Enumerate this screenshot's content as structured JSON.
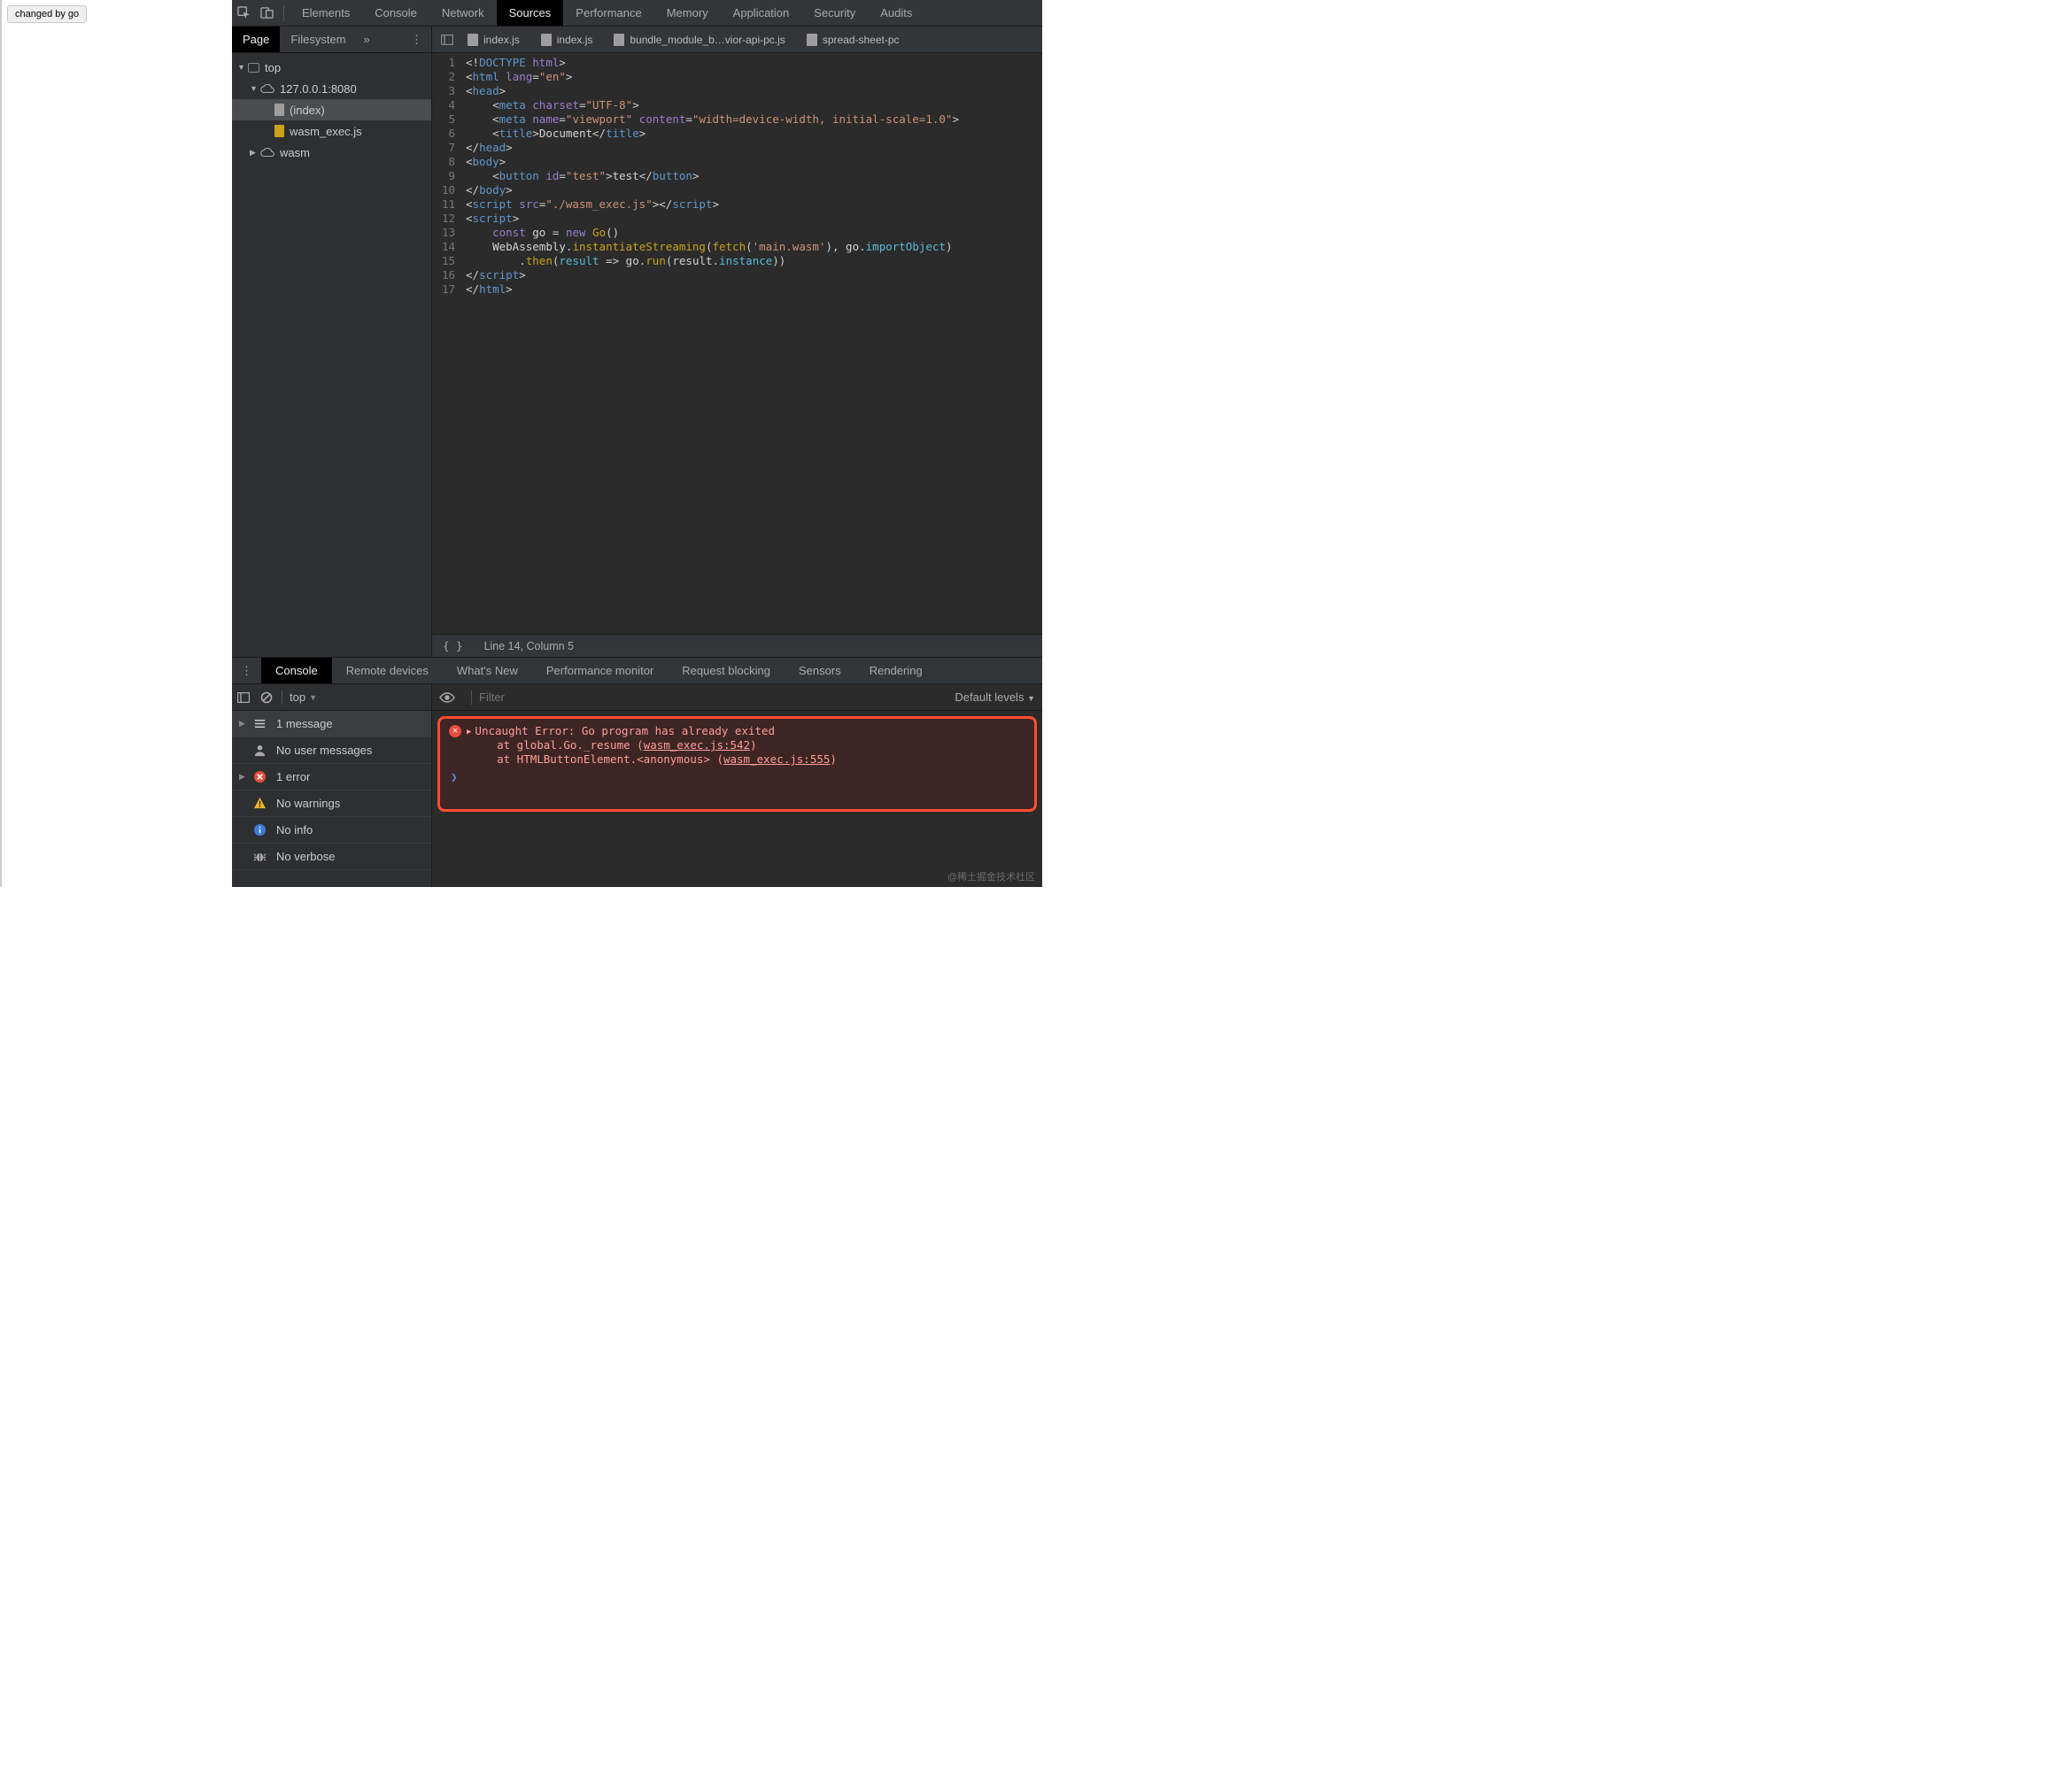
{
  "page": {
    "button_label": "changed by go"
  },
  "topbar": {
    "tabs": [
      "Elements",
      "Console",
      "Network",
      "Sources",
      "Performance",
      "Memory",
      "Application",
      "Security",
      "Audits"
    ],
    "active": "Sources"
  },
  "nav": {
    "tabs": {
      "page": "Page",
      "filesystem": "Filesystem"
    },
    "tree": {
      "top": "top",
      "host": "127.0.0.1:8080",
      "index": "(index)",
      "wasm_exec": "wasm_exec.js",
      "wasm_folder": "wasm"
    }
  },
  "file_tabs": [
    "index.js",
    "index.js",
    "bundle_module_b…vior-api-pc.js",
    "spread-sheet-pc"
  ],
  "code": {
    "lines": [
      {
        "n": 1,
        "h": "<span class='tk-punc'>&lt;!</span><span class='tk-tag'>DOCTYPE</span> <span class='tk-attr'>html</span><span class='tk-punc'>&gt;</span>"
      },
      {
        "n": 2,
        "h": "<span class='tk-punc'>&lt;</span><span class='tk-tag'>html</span> <span class='tk-attr'>lang</span><span class='tk-punc'>=</span><span class='tk-str'>\"en\"</span><span class='tk-punc'>&gt;</span>"
      },
      {
        "n": 3,
        "h": "<span class='tk-punc'>&lt;</span><span class='tk-tag'>head</span><span class='tk-punc'>&gt;</span>"
      },
      {
        "n": 4,
        "h": "    <span class='tk-punc'>&lt;</span><span class='tk-tag'>meta</span> <span class='tk-attr'>charset</span><span class='tk-punc'>=</span><span class='tk-str'>\"UTF-8\"</span><span class='tk-punc'>&gt;</span>"
      },
      {
        "n": 5,
        "h": "    <span class='tk-punc'>&lt;</span><span class='tk-tag'>meta</span> <span class='tk-attr'>name</span><span class='tk-punc'>=</span><span class='tk-str'>\"viewport\"</span> <span class='tk-attr'>content</span><span class='tk-punc'>=</span><span class='tk-str'>\"width=device-width, initial-scale=1.0\"</span><span class='tk-punc'>&gt;</span>"
      },
      {
        "n": 6,
        "h": "    <span class='tk-punc'>&lt;</span><span class='tk-tag'>title</span><span class='tk-punc'>&gt;</span><span class='tk-text'>Document</span><span class='tk-punc'>&lt;/</span><span class='tk-tag'>title</span><span class='tk-punc'>&gt;</span>"
      },
      {
        "n": 7,
        "h": "<span class='tk-punc'>&lt;/</span><span class='tk-tag'>head</span><span class='tk-punc'>&gt;</span>"
      },
      {
        "n": 8,
        "h": "<span class='tk-punc'>&lt;</span><span class='tk-tag'>body</span><span class='tk-punc'>&gt;</span>"
      },
      {
        "n": 9,
        "h": "    <span class='tk-punc'>&lt;</span><span class='tk-tag'>button</span> <span class='tk-attr'>id</span><span class='tk-punc'>=</span><span class='tk-str'>\"test\"</span><span class='tk-punc'>&gt;</span><span class='tk-text'>test</span><span class='tk-punc'>&lt;/</span><span class='tk-tag'>button</span><span class='tk-punc'>&gt;</span>"
      },
      {
        "n": 10,
        "h": "<span class='tk-punc'>&lt;/</span><span class='tk-tag'>body</span><span class='tk-punc'>&gt;</span>"
      },
      {
        "n": 11,
        "h": "<span class='tk-punc'>&lt;</span><span class='tk-tag'>script</span> <span class='tk-attr'>src</span><span class='tk-punc'>=</span><span class='tk-str'>\"./wasm_exec.js\"</span><span class='tk-punc'>&gt;&lt;/</span><span class='tk-tag'>script</span><span class='tk-punc'>&gt;</span>"
      },
      {
        "n": 12,
        "h": "<span class='tk-punc'>&lt;</span><span class='tk-tag'>script</span><span class='tk-punc'>&gt;</span>"
      },
      {
        "n": 13,
        "h": "    <span class='tk-kw'>const</span> <span class='tk-text'>go</span> <span class='tk-op'>=</span> <span class='tk-kw'>new</span> <span class='tk-fn'>Go</span><span class='tk-punc'>()</span>"
      },
      {
        "n": 14,
        "h": "    <span class='tk-text'>WebAssembly</span><span class='tk-punc'>.</span><span class='tk-fn'>instantiateStreaming</span><span class='tk-punc'>(</span><span class='tk-fn'>fetch</span><span class='tk-punc'>(</span><span class='tk-str'>'main.wasm'</span><span class='tk-punc'>),</span> <span class='tk-text'>go</span><span class='tk-punc'>.</span><span class='tk-var'>importObject</span><span class='tk-punc'>)</span>"
      },
      {
        "n": 15,
        "h": "        <span class='tk-punc'>.</span><span class='tk-fn'>then</span><span class='tk-punc'>(</span><span class='tk-var'>result</span> <span class='tk-op'>=&gt;</span> <span class='tk-text'>go</span><span class='tk-punc'>.</span><span class='tk-fn'>run</span><span class='tk-punc'>(</span><span class='tk-text'>result</span><span class='tk-punc'>.</span><span class='tk-var'>instance</span><span class='tk-punc'>))</span>"
      },
      {
        "n": 16,
        "h": "<span class='tk-punc'>&lt;/</span><span class='tk-tag'>script</span><span class='tk-punc'>&gt;</span>"
      },
      {
        "n": 17,
        "h": "<span class='tk-punc'>&lt;/</span><span class='tk-tag'>html</span><span class='tk-punc'>&gt;</span>"
      }
    ]
  },
  "status": {
    "cursor": "Line 14, Column 5"
  },
  "drawer": {
    "tabs": [
      "Console",
      "Remote devices",
      "What's New",
      "Performance monitor",
      "Request blocking",
      "Sensors",
      "Rendering"
    ],
    "active": "Console",
    "context": "top",
    "filter_ph": "Filter",
    "levels": "Default levels",
    "sidebar": {
      "messages": "1 message",
      "user": "No user messages",
      "errors": "1 error",
      "warnings": "No warnings",
      "info": "No info",
      "verbose": "No verbose"
    },
    "error": {
      "title": "Uncaught Error: Go program has already exited",
      "l1_pre": "    at global.Go._resume (",
      "l1_link": "wasm_exec.js:542",
      "l1_post": ")",
      "l2_pre": "    at HTMLButtonElement.<anonymous> (",
      "l2_link": "wasm_exec.js:555",
      "l2_post": ")"
    }
  },
  "watermark": "@稀土掘金技术社区"
}
